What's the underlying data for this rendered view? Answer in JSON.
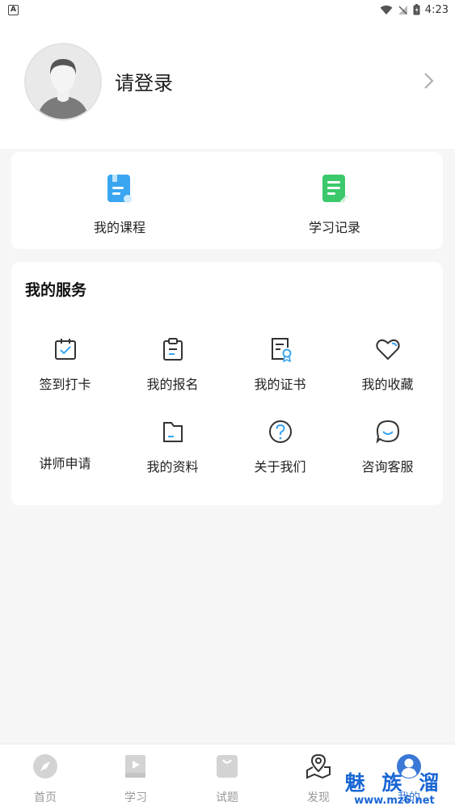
{
  "status_bar": {
    "notification_letter": "A",
    "time": "4:23"
  },
  "profile": {
    "login_text": "请登录"
  },
  "top_shortcuts": [
    {
      "label": "我的课程",
      "icon": "course-book-icon",
      "color": "#3aa5f0"
    },
    {
      "label": "学习记录",
      "icon": "study-record-icon",
      "color": "#3cc96b"
    }
  ],
  "services": {
    "title": "我的服务",
    "items": [
      {
        "label": "签到打卡",
        "icon": "calendar-check-icon"
      },
      {
        "label": "我的报名",
        "icon": "clipboard-icon"
      },
      {
        "label": "我的证书",
        "icon": "certificate-icon"
      },
      {
        "label": "我的收藏",
        "icon": "heart-icon"
      },
      {
        "label": "讲师申请",
        "icon": "lecturer-apply-icon"
      },
      {
        "label": "我的资料",
        "icon": "folder-icon"
      },
      {
        "label": "关于我们",
        "icon": "question-circle-icon"
      },
      {
        "label": "咨询客服",
        "icon": "chat-bubble-icon"
      }
    ]
  },
  "tabbar": {
    "items": [
      {
        "label": "首页",
        "icon": "compass-icon"
      },
      {
        "label": "学习",
        "icon": "learning-book-icon"
      },
      {
        "label": "试题",
        "icon": "exam-bag-icon"
      },
      {
        "label": "发现",
        "icon": "discover-map-icon"
      },
      {
        "label": "我的",
        "icon": "user-profile-icon"
      }
    ],
    "active_index": 4,
    "active_color": "#3a78d6",
    "inactive_color": "#999999"
  },
  "watermark": {
    "name": "魅 族 溜",
    "url": "www.mz6.net"
  }
}
